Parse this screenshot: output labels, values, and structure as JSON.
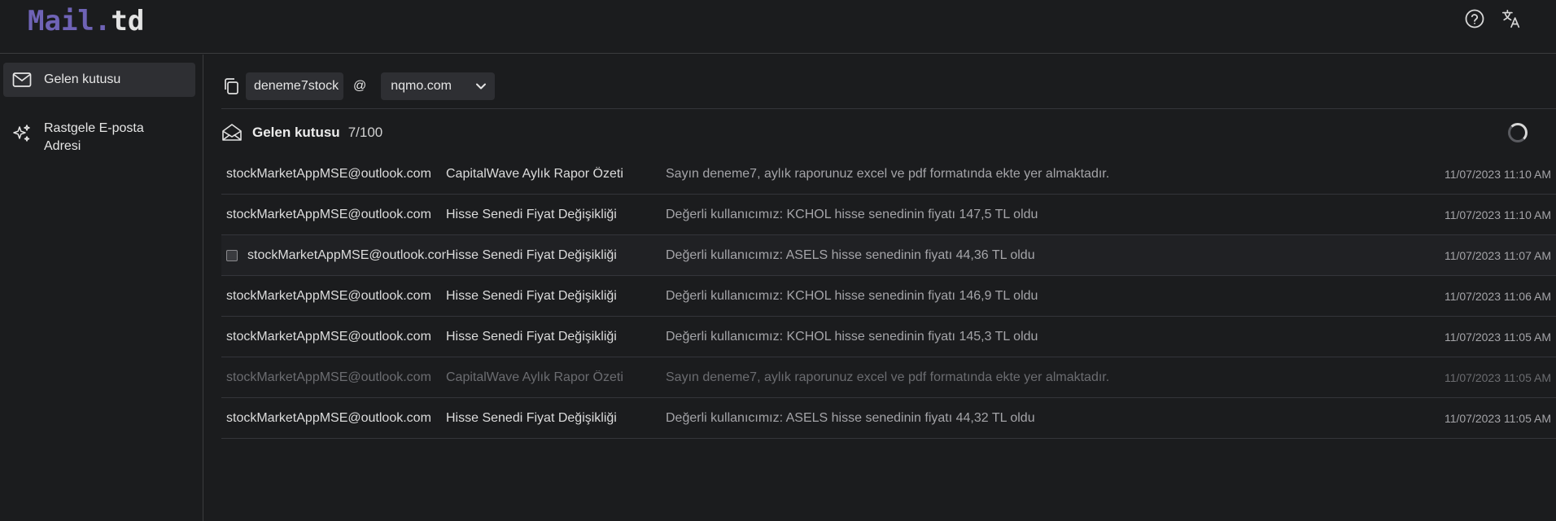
{
  "app": {
    "logo_main": "Mail",
    "logo_dot": ".",
    "logo_suffix": "td"
  },
  "header": {
    "help_icon": "help-circle-icon",
    "language_icon": "translate-icon"
  },
  "sidebar": {
    "items": [
      {
        "label": "Gelen kutusu",
        "icon": "mail-icon",
        "active": true
      },
      {
        "label": "Rastgele E-posta Adresi",
        "icon": "sparkles-icon",
        "active": false
      }
    ]
  },
  "address": {
    "local_part": "deneme7stock",
    "at": "@",
    "domain": "nqmo.com"
  },
  "inbox": {
    "title": "Gelen kutusu",
    "count": "7/100"
  },
  "emails": [
    {
      "from": "stockMarketAppMSE@outlook.com",
      "subject": "CapitalWave Aylık Rapor Özeti",
      "preview": "Sayın deneme7, aylık raporunuz excel ve pdf formatında ekte yer almaktadır.",
      "date": "11/07/2023 11:10 AM",
      "read": false
    },
    {
      "from": "stockMarketAppMSE@outlook.com",
      "subject": "Hisse Senedi Fiyat Değişikliği",
      "preview": "Değerli kullanıcımız: KCHOL hisse senedinin fiyatı 147,5 TL oldu",
      "date": "11/07/2023 11:10 AM",
      "read": false
    },
    {
      "from": "stockMarketAppMSE@outlook.com",
      "subject": "Hisse Senedi Fiyat Değişikliği",
      "preview": "Değerli kullanıcımız: ASELS hisse senedinin fiyatı 44,36 TL oldu",
      "date": "11/07/2023 11:07 AM",
      "read": false,
      "hover": true
    },
    {
      "from": "stockMarketAppMSE@outlook.com",
      "subject": "Hisse Senedi Fiyat Değişikliği",
      "preview": "Değerli kullanıcımız: KCHOL hisse senedinin fiyatı 146,9 TL oldu",
      "date": "11/07/2023 11:06 AM",
      "read": false
    },
    {
      "from": "stockMarketAppMSE@outlook.com",
      "subject": "Hisse Senedi Fiyat Değişikliği",
      "preview": "Değerli kullanıcımız: KCHOL hisse senedinin fiyatı 145,3 TL oldu",
      "date": "11/07/2023 11:05 AM",
      "read": false
    },
    {
      "from": "stockMarketAppMSE@outlook.com",
      "subject": "CapitalWave Aylık Rapor Özeti",
      "preview": "Sayın deneme7, aylık raporunuz excel ve pdf formatında ekte yer almaktadır.",
      "date": "11/07/2023 11:05 AM",
      "read": true
    },
    {
      "from": "stockMarketAppMSE@outlook.com",
      "subject": "Hisse Senedi Fiyat Değişikliği",
      "preview": "Değerli kullanıcımız: ASELS hisse senedinin fiyatı 44,32 TL oldu",
      "date": "11/07/2023 11:05 AM",
      "read": false
    }
  ]
}
